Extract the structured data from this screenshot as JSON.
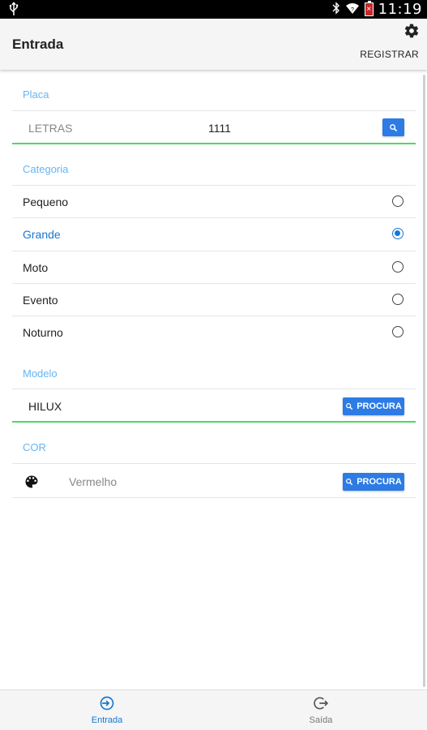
{
  "status_bar": {
    "time": "11:19",
    "icons": [
      "usb-icon",
      "bluetooth-icon",
      "wifi-icon",
      "battery-icon"
    ]
  },
  "header": {
    "title": "Entrada",
    "action_label": "REGISTRAR",
    "settings_icon": "gear-icon"
  },
  "placa": {
    "section_label": "Placa",
    "letters_placeholder": "LETRAS",
    "numbers_value": "1111"
  },
  "categoria": {
    "section_label": "Categoria",
    "options": [
      {
        "label": "Pequeno",
        "selected": false
      },
      {
        "label": "Grande",
        "selected": true
      },
      {
        "label": "Moto",
        "selected": false
      },
      {
        "label": "Evento",
        "selected": false
      },
      {
        "label": "Noturno",
        "selected": false
      }
    ]
  },
  "modelo": {
    "section_label": "Modelo",
    "value": "HILUX",
    "button_label": "PROCURA"
  },
  "cor": {
    "section_label": "COR",
    "placeholder": "Vermelho",
    "button_label": "PROCURA",
    "icon": "palette-icon"
  },
  "bottom_nav": {
    "items": [
      {
        "label": "Entrada",
        "icon": "login-icon",
        "active": true
      },
      {
        "label": "Saída",
        "icon": "logout-icon",
        "active": false
      }
    ]
  },
  "colors": {
    "accent": "#1976d2",
    "section_label": "#64b5f6",
    "button": "#2d7be5",
    "focus_underline": "#4cd964"
  }
}
